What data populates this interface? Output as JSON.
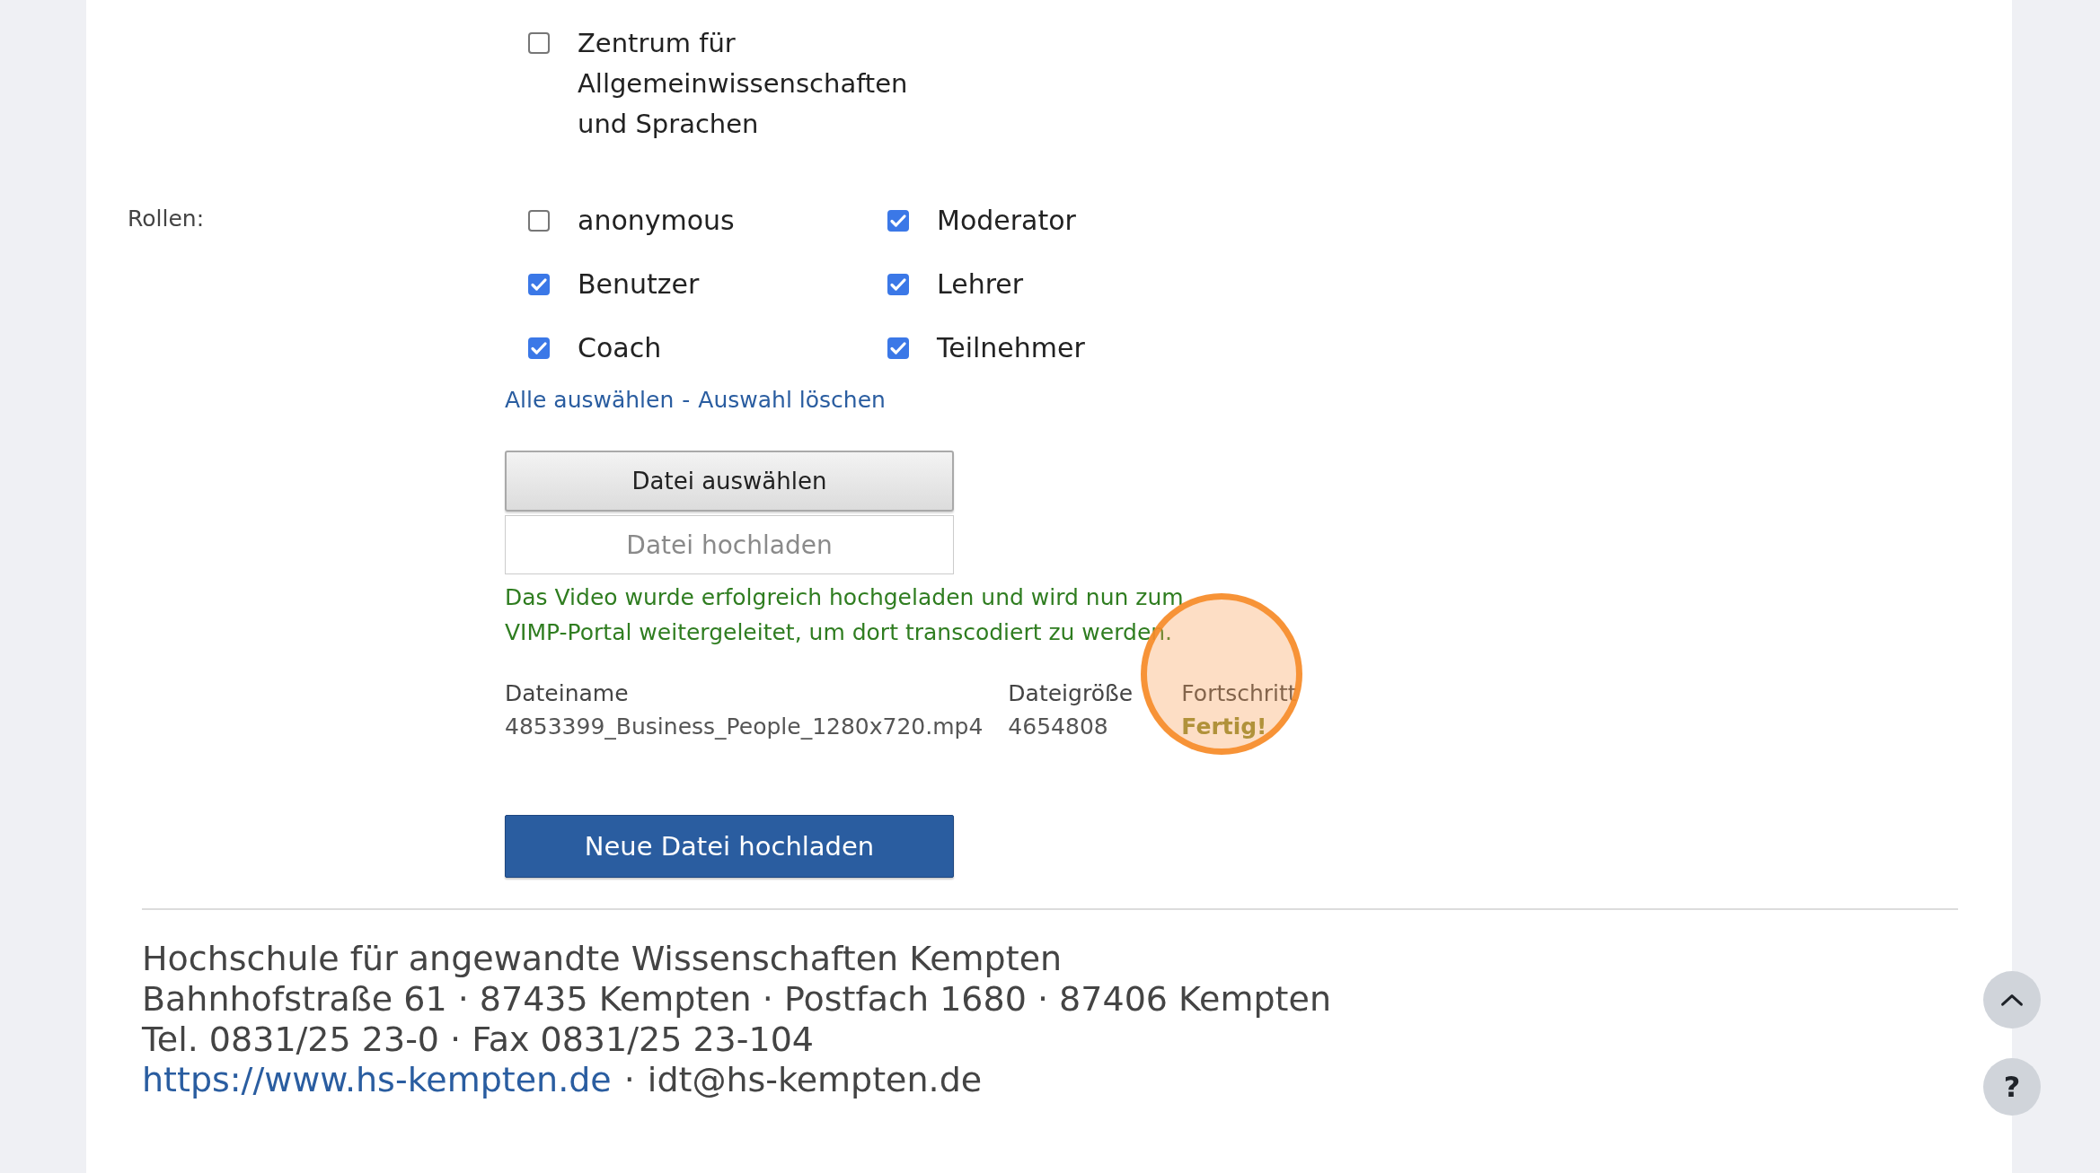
{
  "faculties": [
    {
      "label": "Zentrum für Allgemeinwissenschaften und Sprachen",
      "checked": false
    }
  ],
  "roles": {
    "label": "Rollen:",
    "items": [
      {
        "label": "anonymous",
        "checked": false
      },
      {
        "label": "Moderator",
        "checked": true
      },
      {
        "label": "Benutzer",
        "checked": true
      },
      {
        "label": "Lehrer",
        "checked": true
      },
      {
        "label": "Coach",
        "checked": true
      },
      {
        "label": "Teilnehmer",
        "checked": true
      }
    ]
  },
  "selection_links": {
    "select_all": "Alle auswählen",
    "separator": "-",
    "clear": "Auswahl löschen"
  },
  "file_chooser": "Datei auswählen",
  "upload_button": {
    "label": "Datei hochladen",
    "disabled": true
  },
  "message": "Das Video wurde erfolgreich hochgeladen und wird nun zum VIMP-Portal weitergeleitet, um dort transcodiert zu werden.",
  "files": {
    "columns": [
      "Dateiname",
      "Dateigröße",
      "Fortschritt"
    ],
    "rows": [
      [
        "4853399_Business_People_1280x720.mp4",
        "4654808",
        "Fertig!"
      ]
    ]
  },
  "new_upload_button": "Neue Datei hochladen",
  "footer": {
    "lines": [
      "Hochschule für angewandte Wissenschaften Kempten",
      "Bahnhofstraße 61 · 87435 Kempten · Postfach 1680 · 87406 Kempten",
      "Tel. 0831/25 23-0 · Fax 0831/25 23-104"
    ],
    "website": "https://www.hs-kempten.de",
    "separator": "·",
    "email": "idt@hs-kempten.de"
  },
  "floating_buttons": [
    {
      "kind": "scroll-top"
    },
    {
      "kind": "help",
      "label": "?"
    }
  ]
}
